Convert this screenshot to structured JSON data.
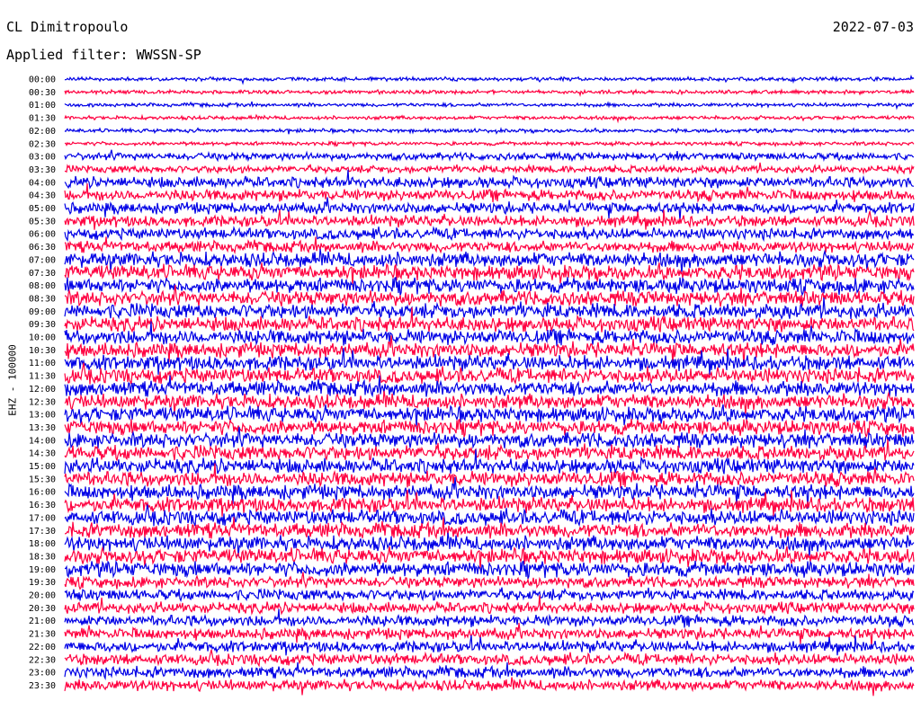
{
  "header": {
    "station": "CL Dimitropoulo",
    "date": "2022-07-03",
    "filter": "Applied filter: WWSSN-SP"
  },
  "chart_data": {
    "type": "line",
    "title": "",
    "ylabel": "EHZ - 100000",
    "xlabel": "",
    "row_labels": [
      "00:00",
      "00:30",
      "01:00",
      "01:30",
      "02:00",
      "02:30",
      "03:00",
      "03:30",
      "04:00",
      "04:30",
      "05:00",
      "05:30",
      "06:00",
      "06:30",
      "07:00",
      "07:30",
      "08:00",
      "08:30",
      "09:00",
      "09:30",
      "10:00",
      "10:30",
      "11:00",
      "11:30",
      "12:00",
      "12:30",
      "13:00",
      "13:30",
      "14:00",
      "14:30",
      "15:00",
      "15:30",
      "16:00",
      "16:30",
      "17:00",
      "17:30",
      "18:00",
      "18:30",
      "19:00",
      "19:30",
      "20:00",
      "20:30",
      "21:00",
      "21:30",
      "22:00",
      "22:30",
      "23:00",
      "23:30"
    ],
    "colors": [
      "#0000e6",
      "#ff0040"
    ],
    "activity": [
      1,
      1,
      1,
      1,
      1,
      1,
      2,
      2,
      3,
      3,
      3,
      3,
      3,
      3,
      4,
      4,
      4,
      4,
      4,
      4,
      4,
      4,
      4,
      4,
      4,
      4,
      4,
      4,
      4,
      4,
      4,
      4,
      4,
      4,
      4,
      4,
      4,
      4,
      4,
      3,
      3,
      3,
      3,
      3,
      3,
      3,
      3,
      3
    ],
    "grid": false
  }
}
